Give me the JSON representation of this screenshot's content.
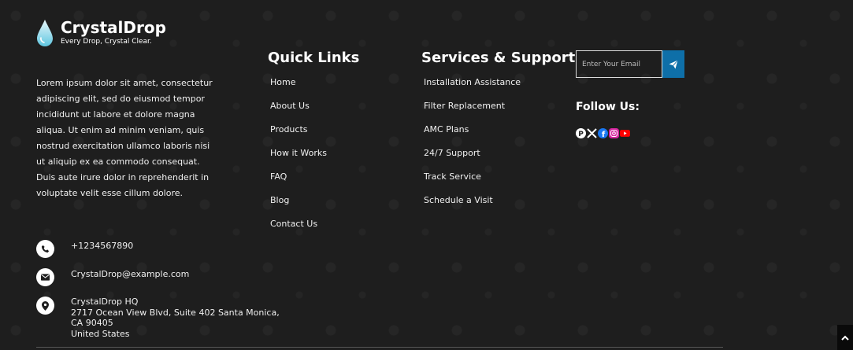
{
  "brand": {
    "name": "CrystalDrop",
    "tagline": "Every Drop, Crystal Clear."
  },
  "about": "Lorem ipsum dolor sit amet, consectetur adipiscing elit, sed do eiusmod tempor incididunt ut labore et dolore magna aliqua. Ut enim ad minim veniam, quis nostrud exercitation ullamco laboris nisi ut aliquip ex ea commodo consequat. Duis aute irure dolor in reprehenderit in voluptate velit esse cillum dolore.",
  "contact": {
    "phone": "+1234567890",
    "email": "CrystalDrop@example.com",
    "address_lines": [
      "CrystalDrop HQ",
      "2717 Ocean View Blvd, Suite 402 Santa Monica,",
      "CA 90405",
      "United States"
    ]
  },
  "quick_links": {
    "title": "Quick Links",
    "items": [
      "Home",
      "About Us",
      "Products",
      "How it Works",
      "FAQ",
      "Blog",
      "Contact Us"
    ]
  },
  "services": {
    "title": "Services & Support",
    "items": [
      "Installation Assistance",
      "Filter Replacement",
      "AMC Plans",
      "24/7 Support",
      "Track Service",
      "Schedule a Visit"
    ]
  },
  "newsletter": {
    "placeholder": "Enter Your Email",
    "send_icon": "paper-plane-icon"
  },
  "follow": {
    "title": "Follow Us:",
    "icons": [
      "pinterest-icon",
      "x-icon",
      "facebook-icon",
      "instagram-icon",
      "youtube-icon"
    ]
  },
  "colors": {
    "background": "#1e1e1e",
    "accent": "#0e6fa8",
    "text": "#ffffff"
  }
}
